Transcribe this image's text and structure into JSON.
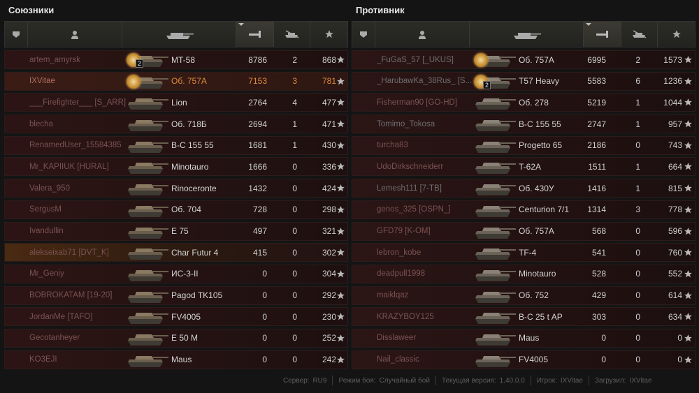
{
  "allies_title": "Союзники",
  "enemies_title": "Противник",
  "columns": [
    "squad-icon",
    "player-icon",
    "tank-icon",
    "damage-icon",
    "kills-icon",
    "xp-star-icon"
  ],
  "allies": [
    {
      "player": "artem_amyrsk",
      "tank": "MT-58",
      "damage": "8786",
      "kills": "2",
      "xp": "868",
      "medal": true,
      "medal_num": "2"
    },
    {
      "player": "IXVitae",
      "tank": "Об. 757A",
      "damage": "7153",
      "kills": "3",
      "xp": "781",
      "medal": true,
      "medal_num": "",
      "self": true
    },
    {
      "player": "___Firefighter___ [S_ARR]",
      "tank": "Lion",
      "damage": "2764",
      "kills": "4",
      "xp": "477"
    },
    {
      "player": "blecha",
      "tank": "Об. 718Б",
      "damage": "2694",
      "kills": "1",
      "xp": "471"
    },
    {
      "player": "RenamedUser_15584385",
      "tank": "B-C 155 55",
      "damage": "1681",
      "kills": "1",
      "xp": "430"
    },
    {
      "player": "Mr_KAPIIUK [HURAL]",
      "tank": "Minotauro",
      "damage": "1666",
      "kills": "0",
      "xp": "336"
    },
    {
      "player": "Valera_950",
      "tank": "Rinoceronte",
      "damage": "1432",
      "kills": "0",
      "xp": "424"
    },
    {
      "player": "SergusM",
      "tank": "Об. 704",
      "damage": "728",
      "kills": "0",
      "xp": "298"
    },
    {
      "player": "Ivandullin",
      "tank": "E 75",
      "damage": "497",
      "kills": "0",
      "xp": "321"
    },
    {
      "player": "alekseixab71 [DVT_K]",
      "tank": "Char Futur 4",
      "damage": "415",
      "kills": "0",
      "xp": "302",
      "squad": true
    },
    {
      "player": "Mr_Geniy",
      "tank": "ИС-3-II",
      "damage": "0",
      "kills": "0",
      "xp": "304"
    },
    {
      "player": "BOBROKATAM [19-20]",
      "tank": "Pagod TK105",
      "damage": "0",
      "kills": "0",
      "xp": "292"
    },
    {
      "player": "JordanMe [TAFO]",
      "tank": "FV4005",
      "damage": "0",
      "kills": "0",
      "xp": "230"
    },
    {
      "player": "Gecotanheyer",
      "tank": "E 50 M",
      "damage": "0",
      "kills": "0",
      "xp": "252"
    },
    {
      "player": "KO3EJI",
      "tank": "Maus",
      "damage": "0",
      "kills": "0",
      "xp": "242"
    }
  ],
  "enemies": [
    {
      "player": "_FuGaS_57 [_UKUS]",
      "tank": "Об. 757A",
      "damage": "6995",
      "kills": "2",
      "xp": "1573",
      "medal": true,
      "medal_num": "",
      "alive": true
    },
    {
      "player": "_HarubawKa_38Rus_ [S...",
      "tank": "T57 Heavy",
      "damage": "5583",
      "kills": "6",
      "xp": "1236",
      "medal": true,
      "medal_num": "2",
      "alive": true
    },
    {
      "player": "Fisherman90 [GO-HD]",
      "tank": "Об. 278",
      "damage": "5219",
      "kills": "1",
      "xp": "1044"
    },
    {
      "player": "Tomimo_Tokosa",
      "tank": "B-C 155 55",
      "damage": "2747",
      "kills": "1",
      "xp": "957",
      "alive": true
    },
    {
      "player": "turcha83",
      "tank": "Progetto 65",
      "damage": "2186",
      "kills": "0",
      "xp": "743"
    },
    {
      "player": "UdoDirkschneiderr",
      "tank": "T-62A",
      "damage": "1511",
      "kills": "1",
      "xp": "664"
    },
    {
      "player": "Lemesh111 [7-TB]",
      "tank": "Об. 430У",
      "damage": "1416",
      "kills": "1",
      "xp": "815",
      "alive": true
    },
    {
      "player": "genos_325 [OSPN_]",
      "tank": "Centurion 7/1",
      "damage": "1314",
      "kills": "3",
      "xp": "778"
    },
    {
      "player": "GFD79 [K-OM]",
      "tank": "Об. 757A",
      "damage": "568",
      "kills": "0",
      "xp": "596"
    },
    {
      "player": "lebron_kobe",
      "tank": "TF-4",
      "damage": "541",
      "kills": "0",
      "xp": "760"
    },
    {
      "player": "deadpull1998",
      "tank": "Minotauro",
      "damage": "528",
      "kills": "0",
      "xp": "552"
    },
    {
      "player": "maiklqaz",
      "tank": "Об. 752",
      "damage": "429",
      "kills": "0",
      "xp": "614"
    },
    {
      "player": "KRAZYBOY125",
      "tank": "B-C 25 t AP",
      "damage": "303",
      "kills": "0",
      "xp": "634"
    },
    {
      "player": "Disslaweer",
      "tank": "Maus",
      "damage": "0",
      "kills": "0",
      "xp": "0"
    },
    {
      "player": "Nail_classic",
      "tank": "FV4005",
      "damage": "0",
      "kills": "0",
      "xp": "0"
    }
  ],
  "footer": {
    "server_label": "Сервер:",
    "server": "RU9",
    "mode_label": "Режим боя:",
    "mode": "Случайный бой",
    "version_label": "Текущая версия:",
    "version": "1.40.0.0",
    "player_label": "Игрок:",
    "player": "IXVitae",
    "uploaded_label": "Загрузил:",
    "uploaded": "IXVitae"
  }
}
